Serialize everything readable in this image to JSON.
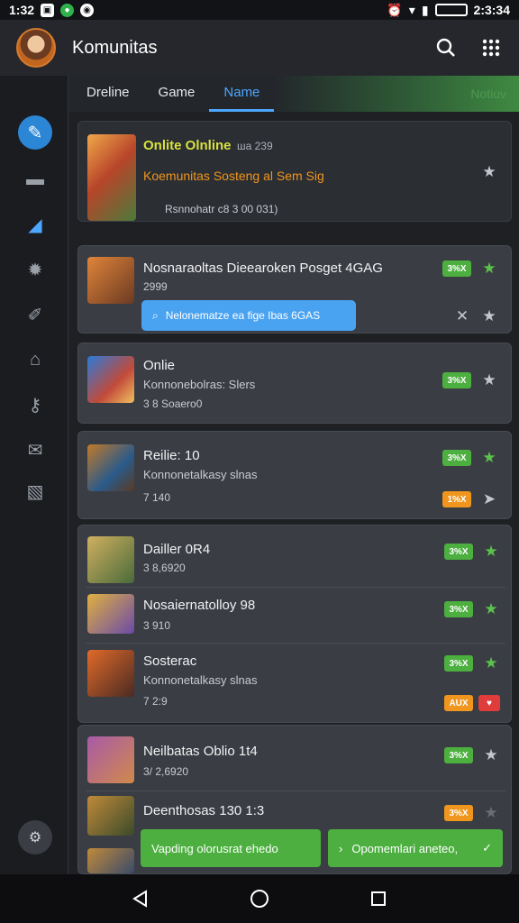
{
  "status_bar": {
    "time": "1:32",
    "right_time": "2:3:34"
  },
  "app_bar": {
    "title": "Komunitas",
    "search_icon": "search-icon",
    "grid_icon": "grid-icon"
  },
  "tabs": {
    "items": [
      "Dreline",
      "Game",
      "Name"
    ],
    "active": "Name",
    "right_label": "Notiuv"
  },
  "featured": {
    "title": "Onlite Olnline",
    "count": "ша 239",
    "subtitle": "Koemunitas Sosteng al Sem Sig",
    "meta": "Rsnnohatr с8 3 00 031)"
  },
  "cards": [
    {
      "title": "Nosnaraoltas Dieearoken Posget 4GAG",
      "sub": "2999",
      "badge": "3%X",
      "pill": "Nelonematze ea fige Ibas 6GAS"
    },
    {
      "title": "Onlie",
      "sub": "Konnonebolras: Slers",
      "sub2": "3 8 Soaero0",
      "badge": "3%X"
    },
    {
      "title": "Reilie: 10",
      "sub": "Konnonetalkasy slnas",
      "sub2": "7 140",
      "badge": "3%X",
      "badge2": "1%X"
    }
  ],
  "group1": [
    {
      "title": "Dailler 0R4",
      "sub": "3 8,6920",
      "badge": "3%X"
    },
    {
      "title": "Nosaiernatolloy 98",
      "sub": "3 910",
      "badge": "3%X"
    },
    {
      "title": "Sosterac",
      "sub": "Konnonetalkasy slnas",
      "sub2": "7 2:9",
      "badge": "3%X",
      "badge2": "AUX"
    }
  ],
  "group2": [
    {
      "title": "Neilbatas Oblio 1t4",
      "sub": "3/ 2,6920",
      "badge": "3%X"
    },
    {
      "title": "Deenthosas 130 1:3",
      "badge": "3%X"
    }
  ],
  "toasts": {
    "left": "Vapding olorusrat ehedo",
    "right": "Opomemlari aneteo,"
  },
  "colors": {
    "accent_blue": "#4da6ff",
    "green": "#4caf3f",
    "orange": "#f0961e",
    "red": "#e03c3c"
  }
}
